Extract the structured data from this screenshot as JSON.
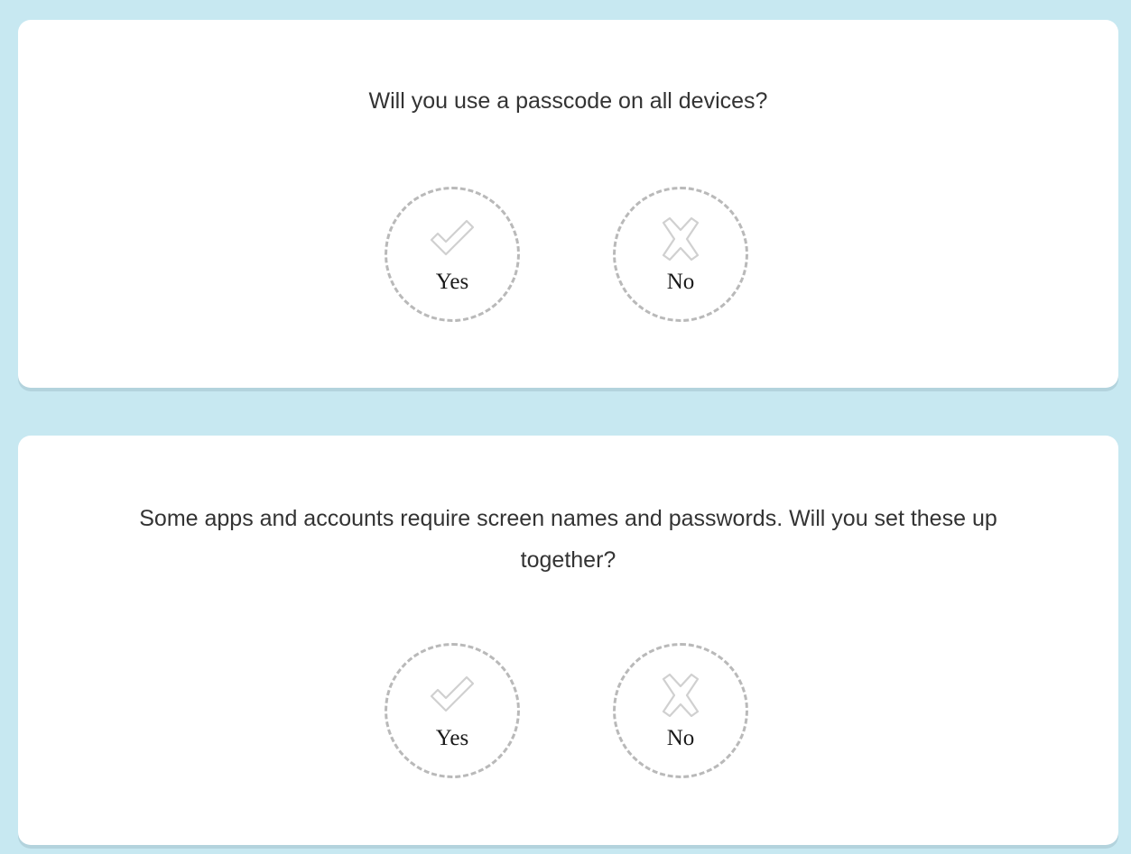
{
  "questions": [
    {
      "text": "Will you use a passcode on all devices?",
      "options": {
        "yes": {
          "label": "Yes",
          "icon": "check-icon"
        },
        "no": {
          "label": "No",
          "icon": "x-icon"
        }
      }
    },
    {
      "text": "Some apps and accounts require screen names and passwords. Will you set these up together?",
      "options": {
        "yes": {
          "label": "Yes",
          "icon": "check-icon"
        },
        "no": {
          "label": "No",
          "icon": "x-icon"
        }
      }
    }
  ],
  "colors": {
    "background": "#c7e8f1",
    "card": "#ffffff",
    "dashed_border": "#b9b9b9",
    "icon_stroke": "#d0d0d0",
    "text": "#333333"
  }
}
